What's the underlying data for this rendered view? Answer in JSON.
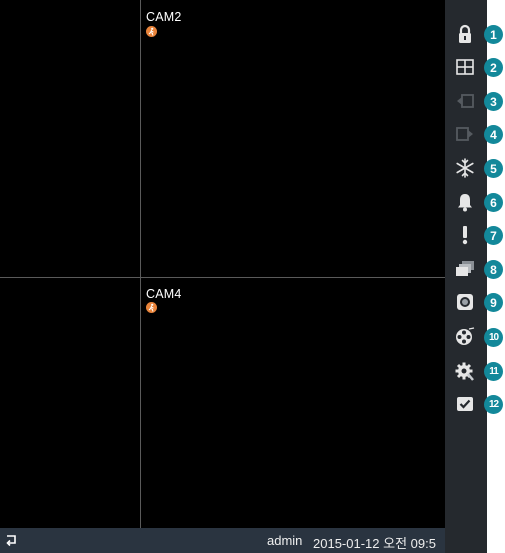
{
  "cameras": {
    "cam2": {
      "label": "CAM2",
      "motion_icon": "motion-run-icon"
    },
    "cam4": {
      "label": "CAM4",
      "motion_icon": "motion-run-icon"
    }
  },
  "status_bar": {
    "left_icon": "return-icon",
    "user": "admin",
    "datetime": "2015-01-12  오전 09:5"
  },
  "toolbar": {
    "items": [
      {
        "icon": "lock-icon",
        "number": "1"
      },
      {
        "icon": "split-screen-icon",
        "number": "2"
      },
      {
        "icon": "previous-icon",
        "number": "3"
      },
      {
        "icon": "next-icon",
        "number": "4"
      },
      {
        "icon": "freeze-icon",
        "number": "5"
      },
      {
        "icon": "alarm-icon",
        "number": "6"
      },
      {
        "icon": "event-icon",
        "number": "7"
      },
      {
        "icon": "sequence-icon",
        "number": "8"
      },
      {
        "icon": "record-icon",
        "number": "9"
      },
      {
        "icon": "playback-icon",
        "number": "10"
      },
      {
        "icon": "setup-icon",
        "number": "11"
      },
      {
        "icon": "check-icon",
        "number": "12"
      }
    ]
  },
  "colors": {
    "toolbar_bg": "#25292e",
    "status_bg": "#2a3440",
    "badge": "#13889a",
    "motion": "#e8833a"
  }
}
